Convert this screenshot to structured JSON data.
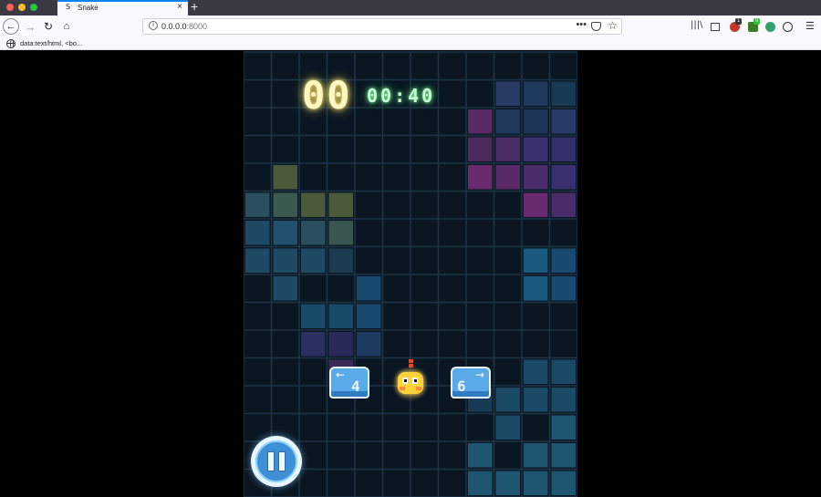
{
  "browser": {
    "tab_title": "Snake",
    "tab_favicon": "S",
    "url_host": "0.0.0.0",
    "url_port": ":8000",
    "status_text": "data:text/html, <bo...",
    "ext_badge_a": "1",
    "ext_badge_b": "0"
  },
  "game": {
    "score": "00",
    "timer": "00:40",
    "left_key": {
      "arrow": "←",
      "number": "4"
    },
    "right_key": {
      "arrow": "→",
      "number": "6"
    },
    "pause_icon": "pause-icon",
    "snake_icon": "snake-head-icon"
  },
  "colors": {
    "board_bg": "#0a1622",
    "grid_line": "#1d3447",
    "score_glow": "#ffe873",
    "timer_glow": "#7cff9a",
    "key_blue": "#5aa9e8"
  },
  "board_tiles": [
    {
      "col": 9,
      "row": 1,
      "color": "#2a3a66"
    },
    {
      "col": 10,
      "row": 1,
      "color": "#1f3a5c"
    },
    {
      "col": 11,
      "row": 1,
      "color": "#173a55"
    },
    {
      "col": 8,
      "row": 2,
      "color": "#5a2a66"
    },
    {
      "col": 9,
      "row": 2,
      "color": "#1f3a5c"
    },
    {
      "col": 10,
      "row": 2,
      "color": "#1c3556"
    },
    {
      "col": 11,
      "row": 2,
      "color": "#2a3a66"
    },
    {
      "col": 8,
      "row": 3,
      "color": "#4e2a5c"
    },
    {
      "col": 9,
      "row": 3,
      "color": "#4c2c66"
    },
    {
      "col": 10,
      "row": 3,
      "color": "#3b3070"
    },
    {
      "col": 11,
      "row": 3,
      "color": "#34306a"
    },
    {
      "col": 1,
      "row": 4,
      "color": "#4a5a3a"
    },
    {
      "col": 8,
      "row": 4,
      "color": "#6a2a6e"
    },
    {
      "col": 9,
      "row": 4,
      "color": "#5a2a6a"
    },
    {
      "col": 10,
      "row": 4,
      "color": "#4a2c6a"
    },
    {
      "col": 11,
      "row": 4,
      "color": "#3a3070"
    },
    {
      "col": 0,
      "row": 5,
      "color": "#2a5060"
    },
    {
      "col": 1,
      "row": 5,
      "color": "#3a5a50"
    },
    {
      "col": 2,
      "row": 5,
      "color": "#4a5a3a"
    },
    {
      "col": 3,
      "row": 5,
      "color": "#4a5a3a"
    },
    {
      "col": 10,
      "row": 5,
      "color": "#6a2a70"
    },
    {
      "col": 11,
      "row": 5,
      "color": "#4a2c6a"
    },
    {
      "col": 0,
      "row": 6,
      "color": "#1e4a66"
    },
    {
      "col": 1,
      "row": 6,
      "color": "#245070"
    },
    {
      "col": 2,
      "row": 6,
      "color": "#2a5060"
    },
    {
      "col": 3,
      "row": 6,
      "color": "#3a5550"
    },
    {
      "col": 0,
      "row": 7,
      "color": "#1e4a66"
    },
    {
      "col": 1,
      "row": 7,
      "color": "#1e4a66"
    },
    {
      "col": 2,
      "row": 7,
      "color": "#1e4a66"
    },
    {
      "col": 3,
      "row": 7,
      "color": "#1c3a50"
    },
    {
      "col": 10,
      "row": 7,
      "color": "#1a5a80"
    },
    {
      "col": 11,
      "row": 7,
      "color": "#1a4a70"
    },
    {
      "col": 1,
      "row": 8,
      "color": "#1e4a66"
    },
    {
      "col": 4,
      "row": 8,
      "color": "#1a4a70"
    },
    {
      "col": 10,
      "row": 8,
      "color": "#1a5a80"
    },
    {
      "col": 11,
      "row": 8,
      "color": "#1a4a70"
    },
    {
      "col": 2,
      "row": 9,
      "color": "#1a4a6a"
    },
    {
      "col": 3,
      "row": 9,
      "color": "#1a4a6a"
    },
    {
      "col": 4,
      "row": 9,
      "color": "#1a4a70"
    },
    {
      "col": 2,
      "row": 10,
      "color": "#2a3060"
    },
    {
      "col": 3,
      "row": 10,
      "color": "#2a2a5a"
    },
    {
      "col": 4,
      "row": 10,
      "color": "#1e3a60"
    },
    {
      "col": 3,
      "row": 11,
      "color": "#3a2a5a"
    },
    {
      "col": 10,
      "row": 11,
      "color": "#1a4a66"
    },
    {
      "col": 11,
      "row": 11,
      "color": "#1a4a66"
    },
    {
      "col": 8,
      "row": 12,
      "color": "#173a55"
    },
    {
      "col": 9,
      "row": 12,
      "color": "#1a4a66"
    },
    {
      "col": 10,
      "row": 12,
      "color": "#1a4a66"
    },
    {
      "col": 11,
      "row": 12,
      "color": "#1a4a66"
    },
    {
      "col": 9,
      "row": 13,
      "color": "#1a4a66"
    },
    {
      "col": 11,
      "row": 13,
      "color": "#1e5570"
    },
    {
      "col": 8,
      "row": 14,
      "color": "#1e5570"
    },
    {
      "col": 10,
      "row": 14,
      "color": "#1e5570"
    },
    {
      "col": 11,
      "row": 14,
      "color": "#1e5570"
    },
    {
      "col": 8,
      "row": 15,
      "color": "#1e5570"
    },
    {
      "col": 9,
      "row": 15,
      "color": "#1e5570"
    },
    {
      "col": 10,
      "row": 15,
      "color": "#1e5570"
    },
    {
      "col": 11,
      "row": 15,
      "color": "#1e5570"
    }
  ]
}
